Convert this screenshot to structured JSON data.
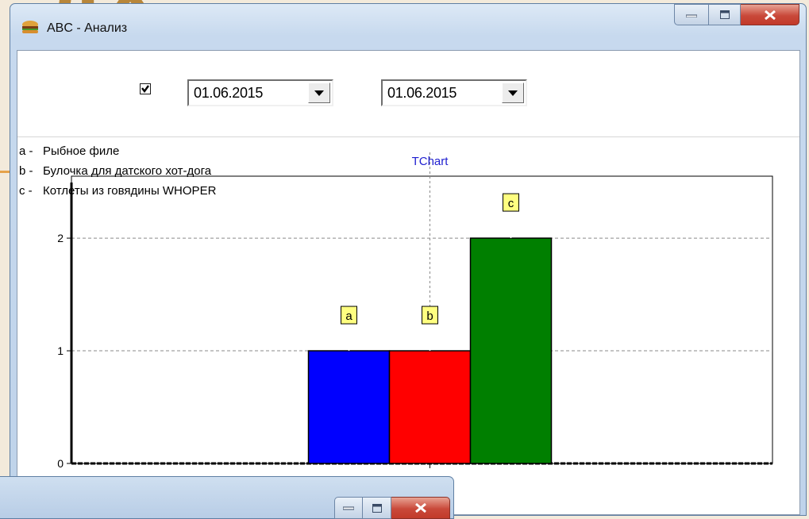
{
  "background": {
    "letters": "ДХ"
  },
  "window": {
    "title": "ABC - Анализ",
    "icon": "burger-icon"
  },
  "toolbar": {
    "checkbox_checked": true,
    "date_from": "01.06.2015",
    "date_to": "01.06.2015"
  },
  "colors": {
    "bar_a": "#0000ff",
    "bar_b": "#ff0000",
    "bar_c": "#007f00",
    "chart_title": "#1f1fd0",
    "mark_fill": "#ffff80"
  },
  "chart_data": {
    "type": "bar",
    "title": "TChart",
    "categories": [
      "a"
    ],
    "series": [
      {
        "name": "a",
        "values": [
          1
        ],
        "color": "#0000ff"
      },
      {
        "name": "b",
        "values": [
          1
        ],
        "color": "#ff0000"
      },
      {
        "name": "c",
        "values": [
          2
        ],
        "color": "#007f00"
      }
    ],
    "yticks": [
      "0",
      "1",
      "2"
    ],
    "ylim": [
      0,
      2.55
    ],
    "grid": true,
    "legend_position": "top-left",
    "legend": [
      {
        "key": "a -",
        "label": "Рыбное филе"
      },
      {
        "key": "b -",
        "label": "Булочка для датского хот-дога"
      },
      {
        "key": "c -",
        "label": "Котлеты из говядины WHOPER"
      }
    ]
  }
}
